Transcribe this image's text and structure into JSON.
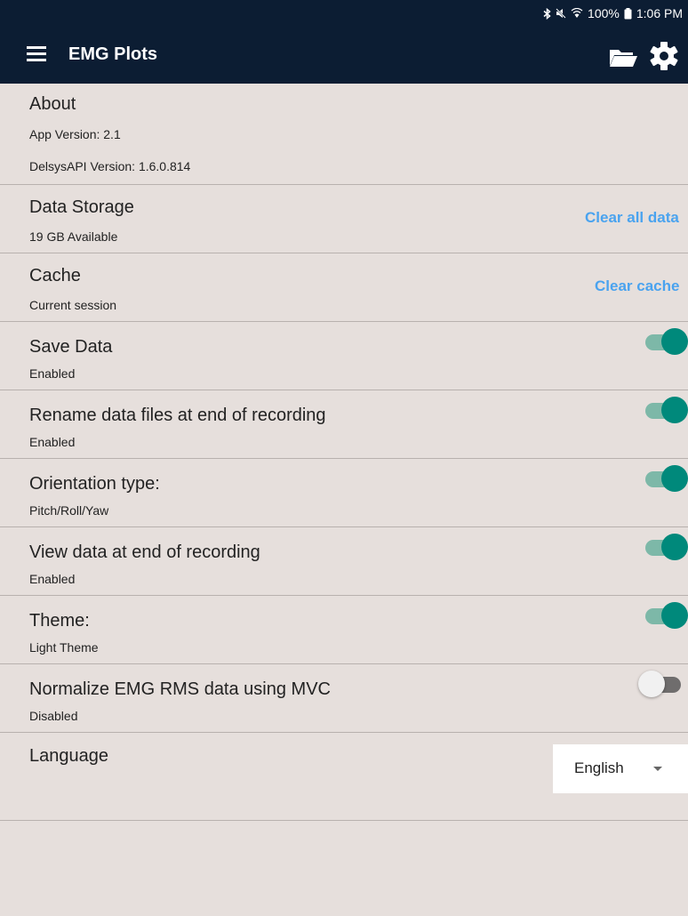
{
  "status_bar": {
    "battery": "100%",
    "time": "1:06 PM"
  },
  "app_bar": {
    "title": "EMG Plots"
  },
  "about": {
    "title": "About",
    "app_version": "App Version: 2.1",
    "api_version": "DelsysAPI Version: 1.6.0.814"
  },
  "data_storage": {
    "title": "Data Storage",
    "subtitle": "19 GB Available",
    "action": "Clear all data"
  },
  "cache": {
    "title": "Cache",
    "subtitle": "Current session",
    "action": "Clear cache"
  },
  "save_data": {
    "title": "Save Data",
    "subtitle": "Enabled",
    "enabled": true
  },
  "rename_files": {
    "title": "Rename data files at end of recording",
    "subtitle": "Enabled",
    "enabled": true
  },
  "orientation": {
    "title": "Orientation type:",
    "subtitle": "Pitch/Roll/Yaw",
    "enabled": true
  },
  "view_data": {
    "title": "View data at end of recording",
    "subtitle": "Enabled",
    "enabled": true
  },
  "theme": {
    "title": "Theme:",
    "subtitle": "Light Theme",
    "enabled": true
  },
  "normalize": {
    "title": "Normalize EMG RMS data using MVC",
    "subtitle": "Disabled",
    "enabled": false
  },
  "language": {
    "title": "Language",
    "selected": "English"
  },
  "colors": {
    "appbar": "#0c1d33",
    "accent": "#00897b",
    "link": "#4aa3ef",
    "background": "#e6dfdc"
  }
}
